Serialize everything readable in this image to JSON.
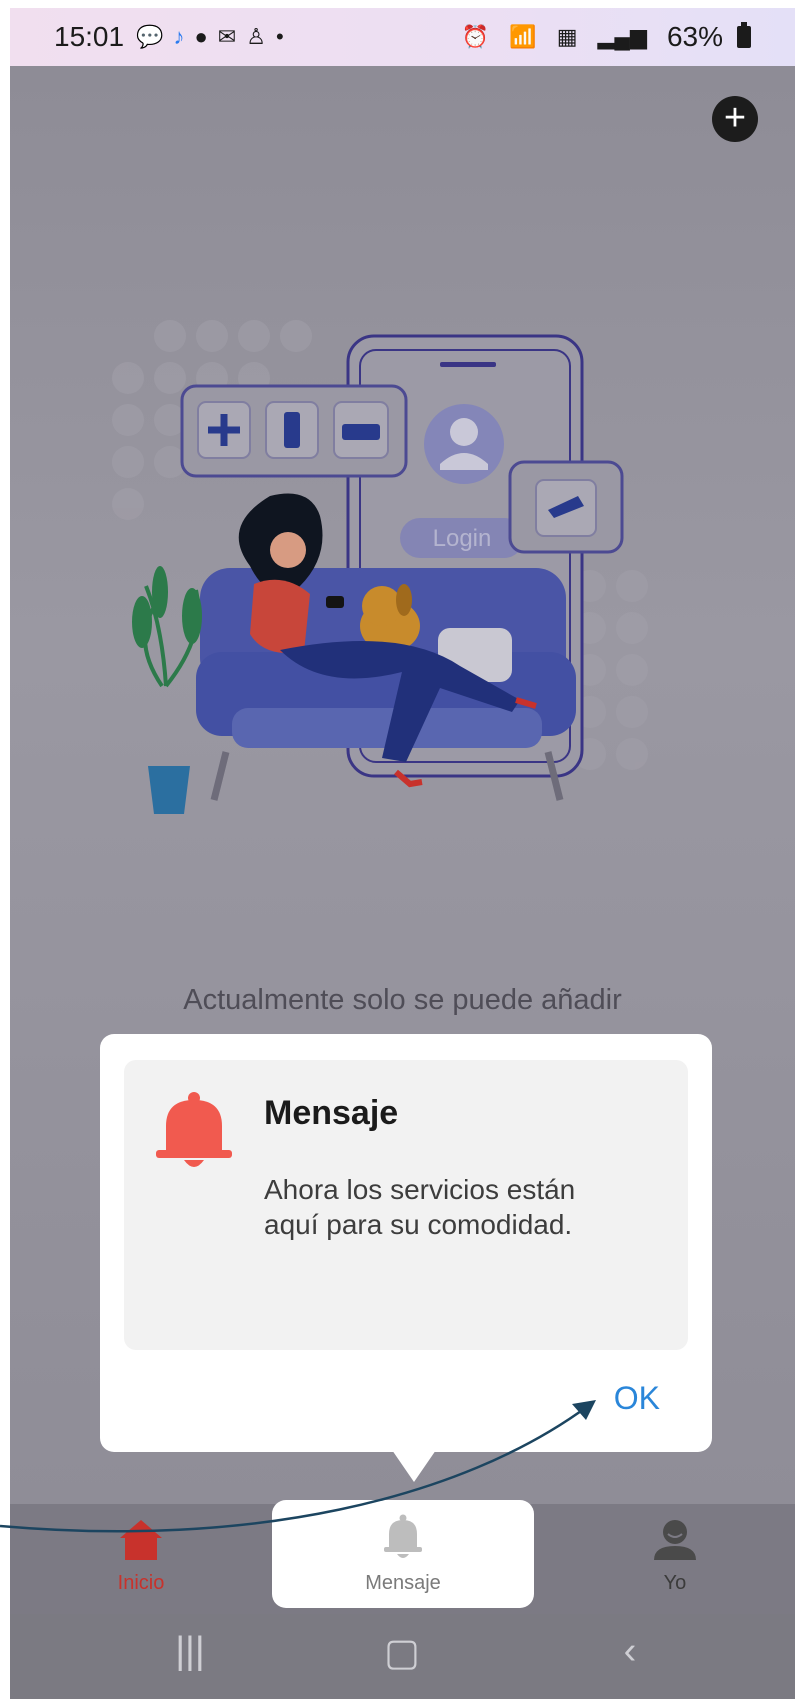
{
  "status_bar": {
    "time": "15:01",
    "battery": "63%",
    "left_icons": [
      "chat-icon",
      "music-icon",
      "ln-icon",
      "mail-icon",
      "person-icon",
      "dot-icon"
    ],
    "right_icons": [
      "alarm-icon",
      "wifi-icon",
      "volte-icon",
      "signal-icon",
      "battery-icon"
    ]
  },
  "header": {
    "add_icon": "plus-circle-icon"
  },
  "illustration": {
    "login_label": "Login"
  },
  "main": {
    "hint": "Actualmente solo se puede añadir"
  },
  "dialog": {
    "title": "Mensaje",
    "body_line1": "Ahora los servicios están",
    "body_line2": "aquí para su comodidad.",
    "ok_label": "OK",
    "icon": "bell-icon",
    "icon_color": "#f15a4f"
  },
  "tabs": [
    {
      "label": "Inicio",
      "icon": "home-icon",
      "active": true,
      "color": "#c8322c"
    },
    {
      "label": "Mensaje",
      "icon": "bell-icon",
      "active": false
    },
    {
      "label": "Yo",
      "icon": "user-icon",
      "active": false
    }
  ],
  "colors": {
    "accent": "#2a86d9",
    "home_red": "#c8322c"
  }
}
